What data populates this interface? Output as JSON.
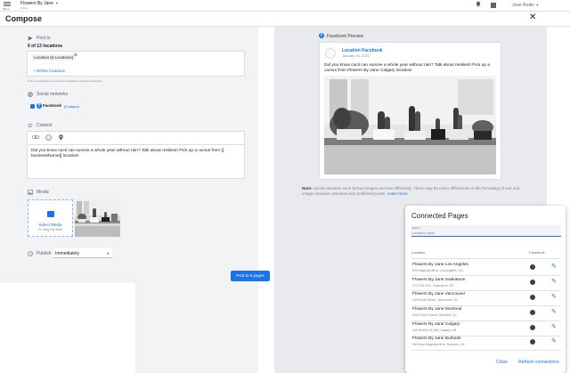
{
  "topbar": {
    "menu_label": "Menu",
    "account_name": "Flowers By Jane",
    "account_sub": "Home",
    "user_name": "Jose Rodin"
  },
  "header": {
    "title": "Compose"
  },
  "post_to": {
    "label": "Post to",
    "count_text": "6 of 13 locations",
    "chip_label": "Location (6 Locations)",
    "refine_link": "+ Refine locations",
    "note": "Note: 1 location(s) do not have a Facebook account connected"
  },
  "social_networks": {
    "label": "Social networks",
    "facebook_label": "Facebook",
    "facebook_count": "(6 pages)",
    "checked": true
  },
  "content": {
    "label": "Content",
    "text": "Did you know cacti can survive a whole year without rain? Talk about resilient! Pick up a cactus from [[ businessName]] location!"
  },
  "media": {
    "label": "Media",
    "upload_title": "Select Media",
    "upload_sub": "Or Drag File Here"
  },
  "publish": {
    "label": "Publish",
    "value": "Immediately"
  },
  "post_button": "Post to 6 pages",
  "preview": {
    "heading": "Facebook Preview",
    "page_name": "Location Facebook",
    "date": "January 20, 2021",
    "post_text": "Did you know cacti can survive a whole year without rain? Talk about resilient! Pick up a cactus from Flowers By Jane Calgary location!",
    "note_bold": "Note:",
    "note_text": "Social networks each format images and text differently. There may be minor differences in the formatting of text and images between previews and published posts.",
    "learn_more": "Learn more"
  },
  "connected_pages": {
    "title": "Connected Pages",
    "search_label": "Search",
    "search_placeholder": "Location name",
    "col_location": "Location",
    "col_facebook": "Facebook",
    "rows": [
      {
        "name": "Flowers By Jane Los Angeles",
        "address": "500 Magnolia Blvd, Los Angeles, CA"
      },
      {
        "name": "Flowers By Jane Saskatoon",
        "address": "212 10th St E, Saskatoon, SK"
      },
      {
        "name": "Flowers By Jane Vancouver",
        "address": "445 South Street, Vancouver, BC"
      },
      {
        "name": "Flowers By Jane Montreal",
        "address": "836 French Street, Montreal, QC"
      },
      {
        "name": "Flowers By Jane Calgary",
        "address": "425 Norfolk Dr NW, Calgary, AB"
      },
      {
        "name": "Flowers By Jane Burbank",
        "address": "565 East Magnolia Blvd, Burbank, CA"
      }
    ],
    "close_label": "Close",
    "refresh_label": "Refresh connections"
  },
  "colors": {
    "accent": "#1a73e8",
    "facebook": "#1877f2",
    "left_panel_bg": "#f1f3f4",
    "preview_bg": "#e8eaed"
  }
}
